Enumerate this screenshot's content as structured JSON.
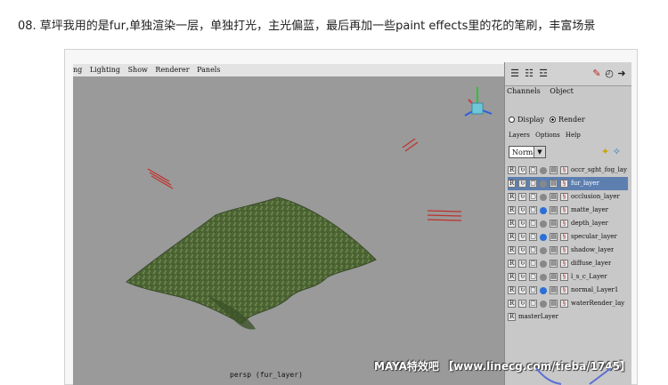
{
  "caption": "08. 草坪我用的是fur,单独渲染一层，单独打光，主光偏蓝，最后再加一些paint effects里的花的笔刷，丰富场景",
  "viewport": {
    "menu": [
      "ng",
      "Lighting",
      "Show",
      "Renderer",
      "Panels"
    ],
    "camera_label": "persp (fur_layer)"
  },
  "panel": {
    "tabs": [
      "Channels",
      "Object"
    ],
    "radio_display": "Display",
    "radio_render": "Render",
    "menus": [
      "Layers",
      "Options",
      "Help"
    ],
    "blend_mode": "Normal",
    "arrow": "▼",
    "layers": [
      {
        "flag": "R",
        "name": "occr_sght_fog_lay",
        "selected": false,
        "ball": "#888888"
      },
      {
        "flag": "R",
        "name": "fur_layer",
        "selected": true,
        "ball": "#888888"
      },
      {
        "flag": "R",
        "name": "occlusion_layer",
        "selected": false,
        "ball": "#888888"
      },
      {
        "flag": "R",
        "name": "matte_layer",
        "selected": false,
        "ball": "#2c6fd8"
      },
      {
        "flag": "R",
        "name": "depth_layer",
        "selected": false,
        "ball": "#888888"
      },
      {
        "flag": "R",
        "name": "specular_layer",
        "selected": false,
        "ball": "#2c6fd8"
      },
      {
        "flag": "R",
        "name": "shadow_layer",
        "selected": false,
        "ball": "#888888"
      },
      {
        "flag": "R",
        "name": "diffuse_layer",
        "selected": false,
        "ball": "#888888"
      },
      {
        "flag": "R",
        "name": "l_s_c_Layer",
        "selected": false,
        "ball": "#888888"
      },
      {
        "flag": "R",
        "name": "normal_Layer1",
        "selected": false,
        "ball": "#2c6fd8"
      },
      {
        "flag": "R",
        "name": "waterRender_lay",
        "selected": false,
        "ball": "#888888"
      }
    ],
    "master_flag": "R",
    "master_layer": "masterLayer"
  },
  "watermark": "MAYA特效吧 【www.linecg.com/tieba/1745】"
}
